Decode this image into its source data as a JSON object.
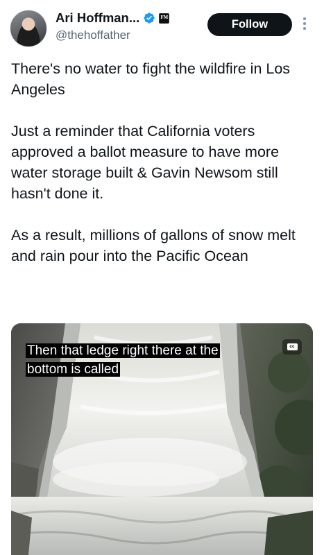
{
  "author": {
    "display_name": "Ari Hoffman...",
    "handle": "@thehoffather",
    "verified": true,
    "badge_text": "FM"
  },
  "actions": {
    "follow_label": "Follow"
  },
  "tweet": {
    "text": "There's no water to fight the wildfire in Los Angeles\n\nJust a reminder that California voters approved a ballot measure to have more water storage built & Gavin Newsom still hasn't done it.\n\nAs a result, millions of gallons of snow melt and rain pour into the Pacific Ocean"
  },
  "media": {
    "type": "video",
    "caption": "Then that ledge right there at the bottom is called",
    "cc_label": "cc"
  },
  "colors": {
    "accent": "#1d9bf0",
    "text_primary": "#0f1419",
    "text_secondary": "#536471",
    "follow_bg": "#0f1419"
  }
}
